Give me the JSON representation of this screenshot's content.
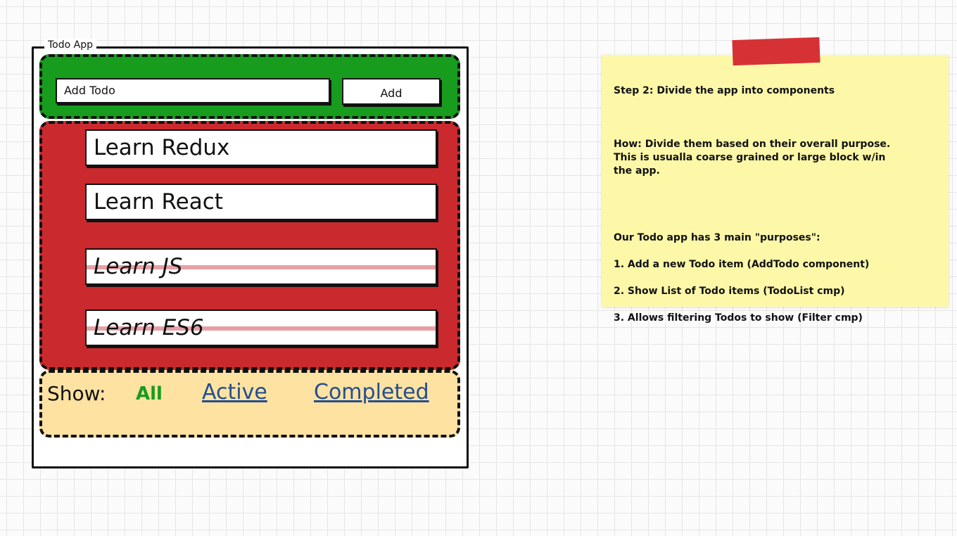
{
  "window": {
    "title": "Todo App"
  },
  "add_todo": {
    "input_placeholder": "Add Todo",
    "button_label": "Add"
  },
  "todos": [
    {
      "text": "Learn Redux",
      "completed": false
    },
    {
      "text": "Learn React",
      "completed": false
    },
    {
      "text": "Learn JS",
      "completed": true
    },
    {
      "text": "Learn ES6",
      "completed": true
    }
  ],
  "filter": {
    "label": "Show:",
    "options": [
      "All",
      "Active",
      "Completed"
    ],
    "selected": "All"
  },
  "note": {
    "title": "Step 2: Divide the app into components",
    "how": "How: Divide them based on their overall purpose.\nThis is usualla  coarse grained or large block w/in\nthe app.",
    "purposes_heading": "Our Todo app has 3 main \"purposes\":",
    "purposes": [
      "1. Add a new Todo item (AddTodo component)",
      "2. Show List of Todo items (TodoList cmp)",
      "3. Allows filtering Todos to show (Filter cmp)"
    ]
  },
  "colors": {
    "add_region": "#179c1e",
    "list_region": "#ca2a2e",
    "filter_region": "#fde2a2",
    "note": "#fdf8a8",
    "tape": "#d63236",
    "link": "#244e8e"
  }
}
